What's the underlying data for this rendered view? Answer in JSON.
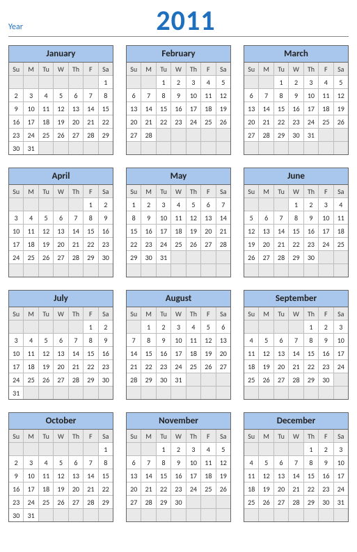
{
  "header": {
    "label": "Year",
    "year": "2011"
  },
  "weekdays": [
    "Su",
    "M",
    "Tu",
    "W",
    "Th",
    "F",
    "Sa"
  ],
  "months": [
    {
      "name": "January",
      "start": 6,
      "days": 31
    },
    {
      "name": "February",
      "start": 2,
      "days": 28
    },
    {
      "name": "March",
      "start": 2,
      "days": 31
    },
    {
      "name": "April",
      "start": 5,
      "days": 30
    },
    {
      "name": "May",
      "start": 0,
      "days": 31
    },
    {
      "name": "June",
      "start": 3,
      "days": 30
    },
    {
      "name": "July",
      "start": 5,
      "days": 31
    },
    {
      "name": "August",
      "start": 1,
      "days": 31
    },
    {
      "name": "September",
      "start": 4,
      "days": 30
    },
    {
      "name": "October",
      "start": 6,
      "days": 31
    },
    {
      "name": "November",
      "start": 2,
      "days": 30
    },
    {
      "name": "December",
      "start": 4,
      "days": 31
    }
  ]
}
